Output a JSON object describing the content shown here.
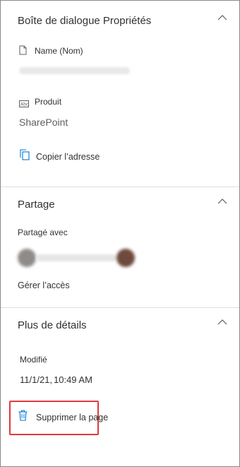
{
  "properties": {
    "title": "Boîte de dialogue Propriétés",
    "name_label": "Name (Nom)",
    "type_label": "Produit",
    "type_value": "SharePoint",
    "copy_address_label": "Copier l’adresse"
  },
  "sharing": {
    "title": "Partage",
    "shared_with_label": "Partagé avec",
    "manage_access_label": "Gérer l’accès"
  },
  "details": {
    "title": "Plus de détails",
    "modified_label": "Modifié",
    "modified_date": "11/1/21,",
    "modified_time": "10:49 AM"
  },
  "actions": {
    "delete_page_label": "Supprimer la page"
  },
  "colors": {
    "accent": "#0078d4",
    "highlight": "#e0393e"
  }
}
